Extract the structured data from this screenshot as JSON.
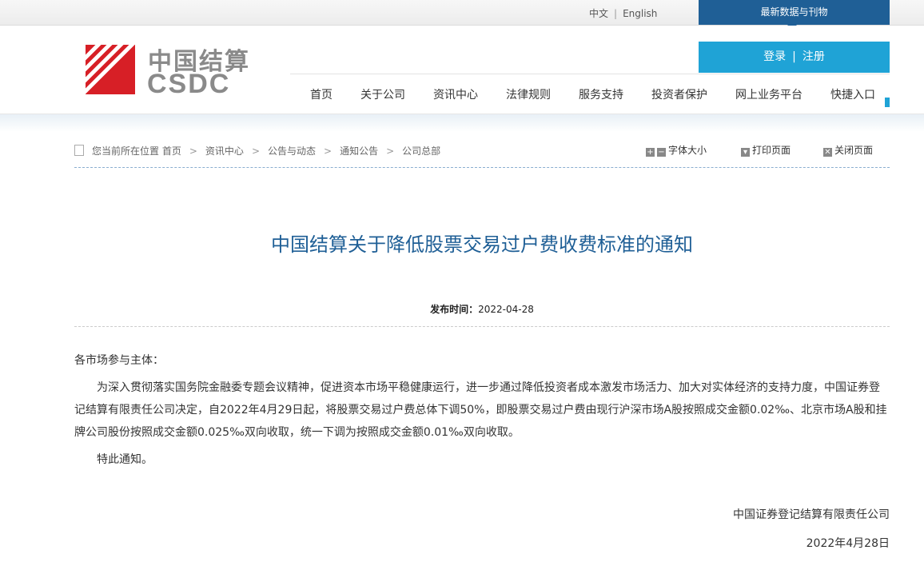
{
  "topbar": {
    "lang_cn": "中文",
    "lang_en": "English",
    "latest_label": "最新数据与刊物"
  },
  "header": {
    "logo_cn": "中国结算",
    "logo_en": "CSDC",
    "login_label": "登录",
    "register_label": "注册",
    "nav_items": [
      "首页",
      "关于公司",
      "资讯中心",
      "法律规则",
      "服务支持",
      "投资者保护",
      "网上业务平台",
      "快捷入口"
    ]
  },
  "breadcrumb": {
    "prefix": "您当前所在位置",
    "items": [
      "首页",
      "资讯中心",
      "公告与动态",
      "通知公告",
      "公司总部"
    ],
    "separator": ">"
  },
  "tools": {
    "font_size_label": "字体大小",
    "print_label": "打印页面",
    "close_label": "关闭页面"
  },
  "article": {
    "title": "中国结算关于降低股票交易过户费收费标准的通知",
    "publish_label": "发布时间：",
    "publish_date": "2022-04-28",
    "salutation": "各市场参与主体：",
    "paragraph1": "为深入贯彻落实国务院金融委专题会议精神，促进资本市场平稳健康运行，进一步通过降低投资者成本激发市场活力、加大对实体经济的支持力度，中国证券登记结算有限责任公司决定，自2022年4月29日起，将股票交易过户费总体下调50%，即股票交易过户费由现行沪深市场A股按照成交金额0.02‰、北京市场A股和挂牌公司股份按照成交金额0.025‰双向收取，统一下调为按照成交金额0.01‰双向收取。",
    "paragraph2": "特此通知。",
    "signature": "中国证券登记结算有限责任公司",
    "sign_date": "2022年4月28日"
  },
  "colors": {
    "brand_blue": "#1f5f96",
    "accent_cyan": "#1fa3d6",
    "logo_red": "#d71f26"
  }
}
